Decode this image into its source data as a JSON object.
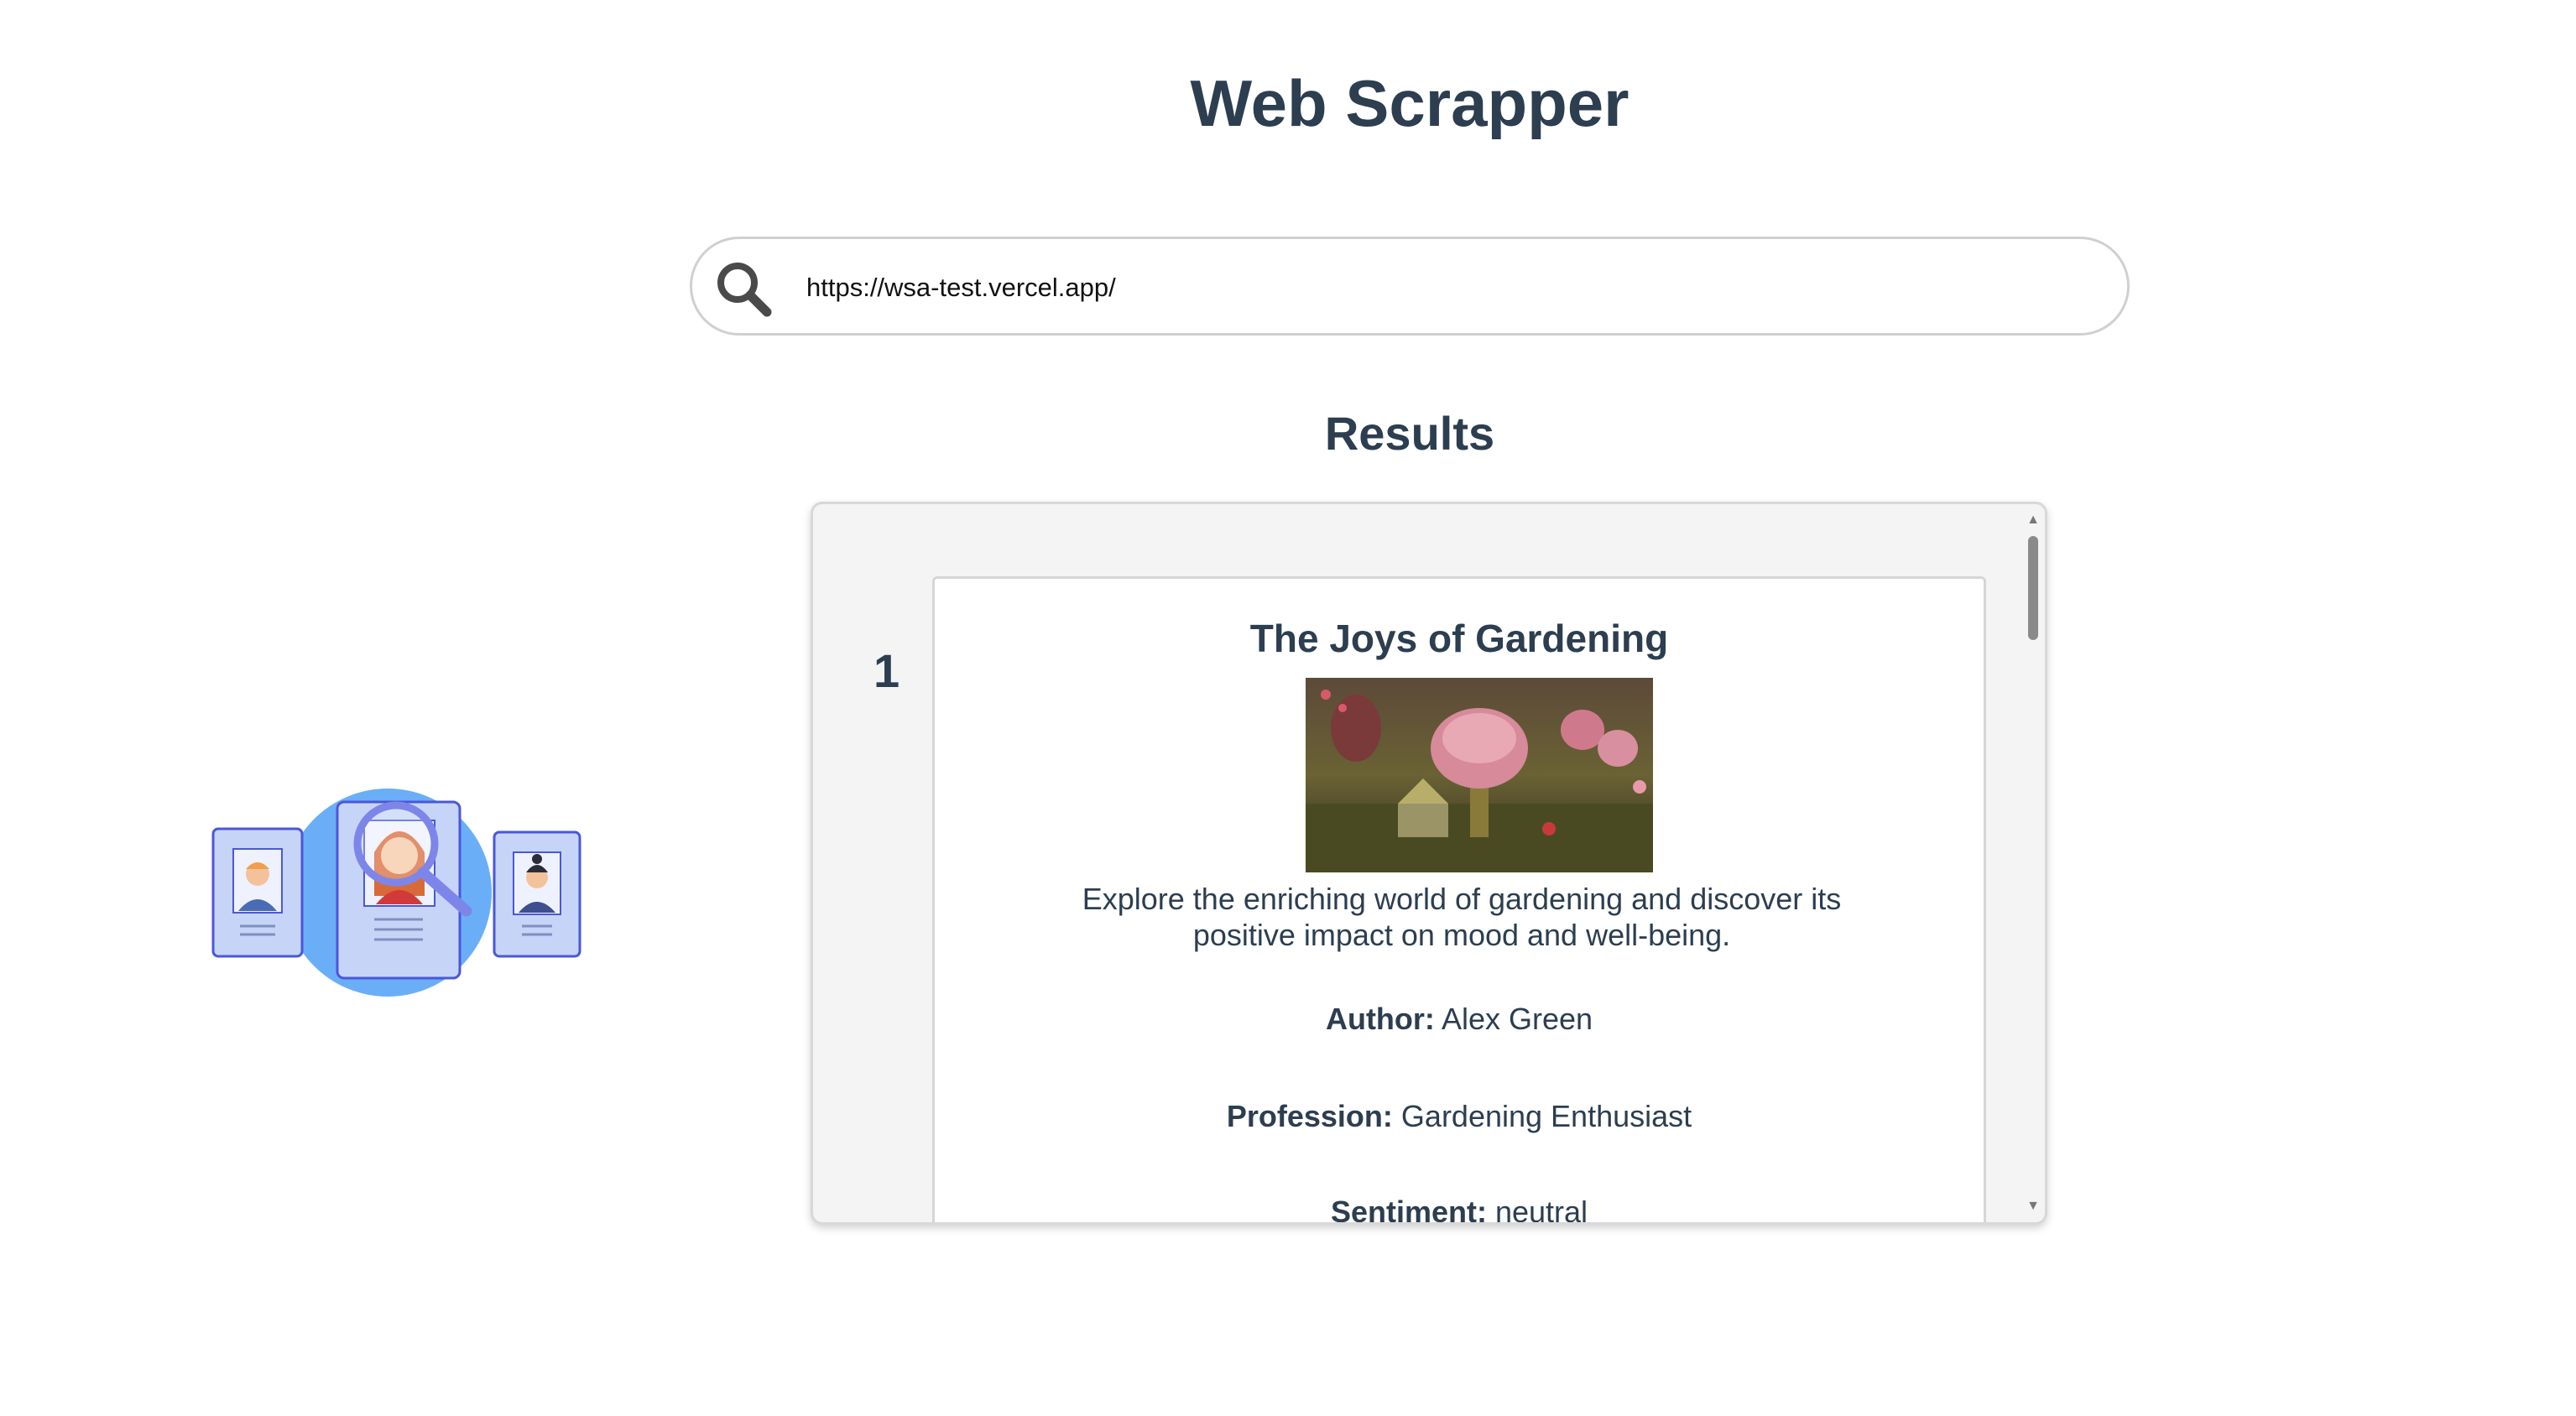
{
  "app": {
    "title": "Web Scrapper"
  },
  "search": {
    "value": "https://wsa-test.vercel.app/",
    "icon": "search-icon"
  },
  "results": {
    "heading": "Results",
    "items": [
      {
        "index": "1",
        "title": "The Joys of Gardening",
        "description": "Explore the enriching world of gardening and discover its positive impact on mood and well-being.",
        "author_label": "Author:",
        "author": "Alex Green",
        "profession_label": "Profession:",
        "profession": "Gardening Enthusiast",
        "sentiment_label": "Sentiment:",
        "sentiment": "neutral"
      }
    ]
  },
  "colors": {
    "text": "#2c3e50",
    "accent_blue": "#6aaef8",
    "card_blue": "#c6d4f8",
    "card_border": "#4b57d8"
  }
}
